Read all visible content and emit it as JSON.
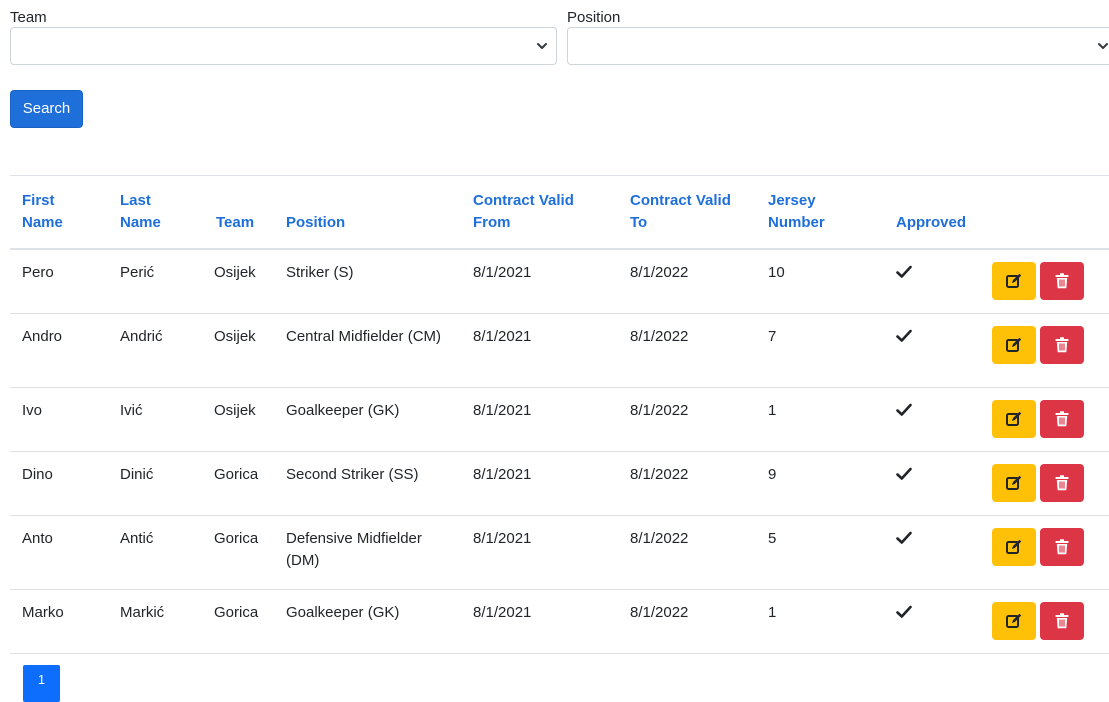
{
  "filters": {
    "team_label": "Team",
    "team_value": "",
    "position_label": "Position",
    "position_value": "",
    "search_button": "Search"
  },
  "table": {
    "headers": {
      "first_name": "First Name",
      "last_name": "Last Name",
      "team": "Team",
      "position": "Position",
      "contract_from": "Contract Valid From",
      "contract_to": "Contract Valid To",
      "jersey": "Jersey Number",
      "approved": "Approved"
    },
    "rows": [
      {
        "first": "Pero",
        "last": "Perić",
        "team": "Osijek",
        "position": "Striker (S)",
        "from": "8/1/2021",
        "to": "8/1/2022",
        "jersey": "10",
        "approved": true
      },
      {
        "first": "Andro",
        "last": "Andrić",
        "team": "Osijek",
        "position": "Central Midfielder (CM)",
        "from": "8/1/2021",
        "to": "8/1/2022",
        "jersey": "7",
        "approved": true
      },
      {
        "first": "Ivo",
        "last": "Ivić",
        "team": "Osijek",
        "position": "Goalkeeper (GK)",
        "from": "8/1/2021",
        "to": "8/1/2022",
        "jersey": "1",
        "approved": true
      },
      {
        "first": "Dino",
        "last": "Dinić",
        "team": "Gorica",
        "position": "Second Striker (SS)",
        "from": "8/1/2021",
        "to": "8/1/2022",
        "jersey": "9",
        "approved": true
      },
      {
        "first": "Anto",
        "last": "Antić",
        "team": "Gorica",
        "position": "Defensive Midfielder (DM)",
        "from": "8/1/2021",
        "to": "8/1/2022",
        "jersey": "5",
        "approved": true
      },
      {
        "first": "Marko",
        "last": "Markić",
        "team": "Gorica",
        "position": "Goalkeeper (GK)",
        "from": "8/1/2021",
        "to": "8/1/2022",
        "jersey": "1",
        "approved": true
      }
    ]
  },
  "pagination": {
    "current_page": "1"
  },
  "colors": {
    "primary": "#1e6fd9",
    "edit": "#ffc107",
    "delete": "#dc3545",
    "page_active": "#0d6efd"
  },
  "icons": {
    "approved": "check-icon",
    "edit": "edit-icon",
    "delete": "trash-icon",
    "select": "chevron-down-icon"
  }
}
